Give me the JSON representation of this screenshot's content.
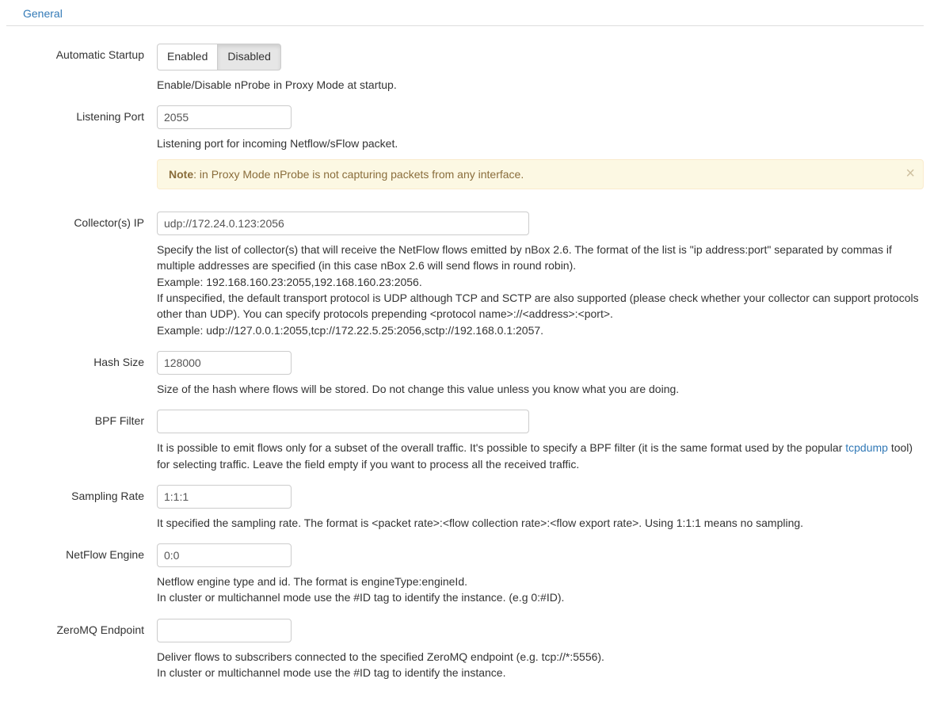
{
  "tab": {
    "general": "General"
  },
  "startup": {
    "label": "Automatic Startup",
    "enabled": "Enabled",
    "disabled": "Disabled",
    "active": "disabled",
    "help": "Enable/Disable nProbe in Proxy Mode at startup."
  },
  "listening": {
    "label": "Listening Port",
    "value": "2055",
    "help": "Listening port for incoming Netflow/sFlow packet.",
    "note_label": "Note",
    "note_text": ": in Proxy Mode nProbe is not capturing packets from any interface.",
    "close": "×"
  },
  "collectors": {
    "label": "Collector(s) IP",
    "value": "udp://172.24.0.123:2056",
    "help1": "Specify the list of collector(s) that will receive the NetFlow flows emitted by nBox 2.6. The format of the list is \"ip address:port\" separated by commas if multiple addresses are specified (in this case nBox 2.6 will send flows in round robin).",
    "help2": "Example: 192.168.160.23:2055,192.168.160.23:2056.",
    "help3": "If unspecified, the default transport protocol is UDP although TCP and SCTP are also supported (please check whether your collector can support protocols other than UDP). You can specify protocols prepending <protocol name>://<address>:<port>.",
    "help4": "Example: udp://127.0.0.1:2055,tcp://172.22.5.25:2056,sctp://192.168.0.1:2057."
  },
  "hash": {
    "label": "Hash Size",
    "value": "128000",
    "help": "Size of the hash where flows will be stored. Do not change this value unless you know what you are doing."
  },
  "bpf": {
    "label": "BPF Filter",
    "value": "",
    "help_pre": "It is possible to emit flows only for a subset of the overall traffic. It's possible to specify a BPF filter (it is the same format used by the popular ",
    "link": "tcpdump",
    "help_post": " tool) for selecting traffic. Leave the field empty if you want to process all the received traffic."
  },
  "sampling": {
    "label": "Sampling Rate",
    "value": "1:1:1",
    "help": "It specified the sampling rate. The format is <packet rate>:<flow collection rate>:<flow export rate>. Using 1:1:1 means no sampling."
  },
  "engine": {
    "label": "NetFlow Engine",
    "value": "0:0",
    "help1": "Netflow engine type and id. The format is engineType:engineId.",
    "help2": "In cluster or multichannel mode use the #ID tag to identify the instance. (e.g 0:#ID)."
  },
  "zmq": {
    "label": "ZeroMQ Endpoint",
    "value": "",
    "help1": "Deliver flows to subscribers connected to the specified ZeroMQ endpoint (e.g. tcp://*:5556).",
    "help2": "In cluster or multichannel mode use the #ID tag to identify the instance."
  }
}
